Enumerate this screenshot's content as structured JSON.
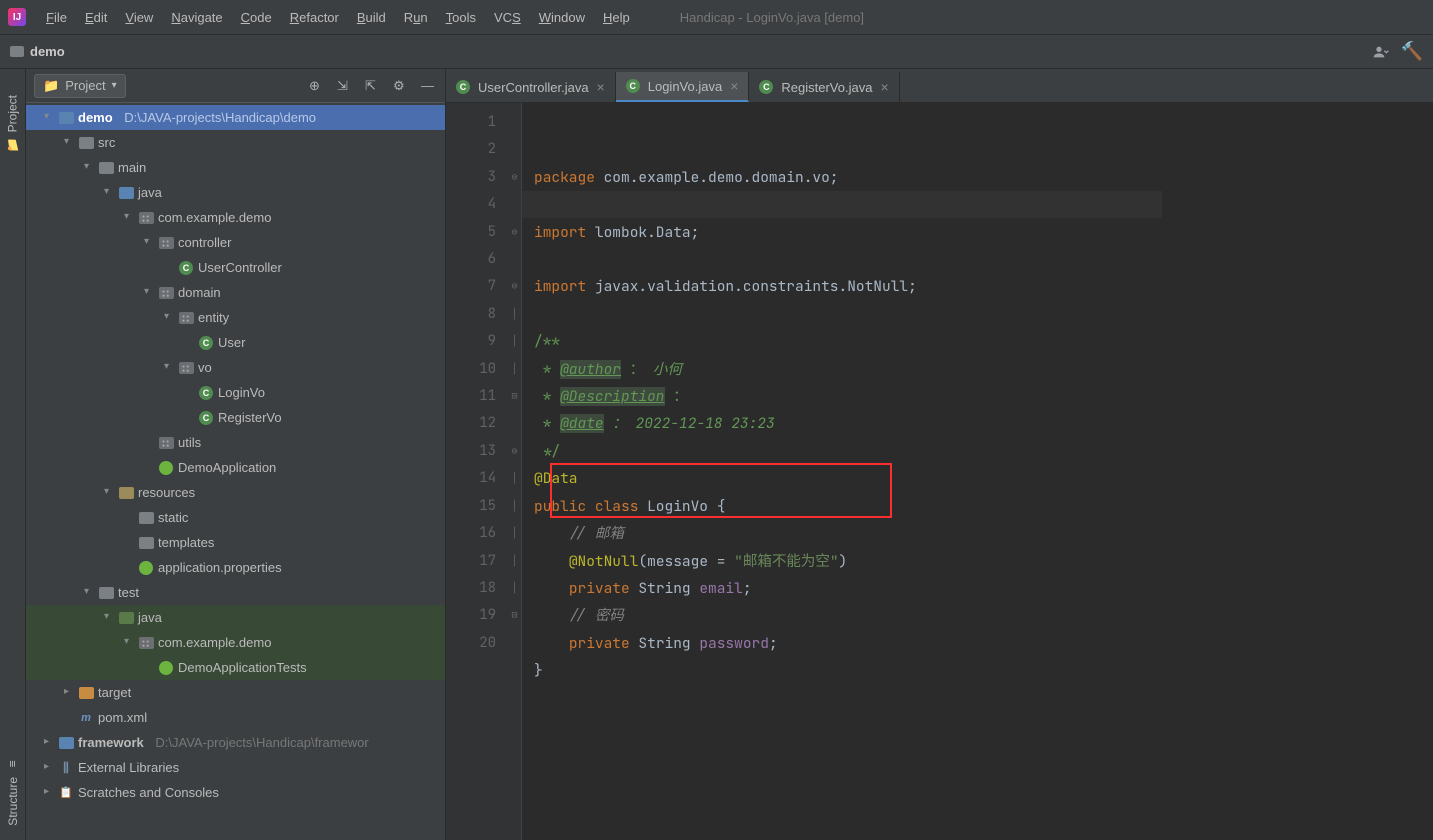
{
  "menubar": [
    "File",
    "Edit",
    "View",
    "Navigate",
    "Code",
    "Refactor",
    "Build",
    "Run",
    "Tools",
    "VCS",
    "Window",
    "Help"
  ],
  "menubar_mnemonics": [
    "F",
    "E",
    "V",
    "N",
    "C",
    "R",
    "B",
    "R",
    "T",
    "S",
    "W",
    "H"
  ],
  "window_title": "Handicap - LoginVo.java [demo]",
  "breadcrumb": "demo",
  "project_panel": {
    "title": "Project"
  },
  "tree": {
    "root": {
      "label": "demo",
      "path": "D:\\JAVA-projects\\Handicap\\demo"
    },
    "src": "src",
    "main": "main",
    "java": "java",
    "pkg": "com.example.demo",
    "controller": "controller",
    "usercontroller": "UserController",
    "domain": "domain",
    "entity": "entity",
    "user": "User",
    "vo": "vo",
    "loginvo": "LoginVo",
    "registervo": "RegisterVo",
    "utils": "utils",
    "demoapp": "DemoApplication",
    "resources": "resources",
    "static": "static",
    "templates": "templates",
    "appprops": "application.properties",
    "test": "test",
    "testjava": "java",
    "testpkg": "com.example.demo",
    "demotests": "DemoApplicationTests",
    "target": "target",
    "pom": "pom.xml",
    "framework": {
      "label": "framework",
      "path": "D:\\JAVA-projects\\Handicap\\framewor"
    },
    "extlibs": "External Libraries",
    "scratches": "Scratches and Consoles"
  },
  "tabs": [
    {
      "label": "UserController.java"
    },
    {
      "label": "LoginVo.java"
    },
    {
      "label": "RegisterVo.java"
    }
  ],
  "code": {
    "l1a": "package",
    "l1b": " com.example.demo.domain.vo;",
    "l3a": "import",
    "l3b": " lombok.Data;",
    "l5a": "import",
    "l5b": " javax.validation.constraints.NotNull;",
    "l7": "/**",
    "l8a": " * ",
    "l8b": "@author",
    "l8c": " ： ",
    "l8d": "小何",
    "l9a": " * ",
    "l9b": "@Description",
    "l9c": " ：",
    "l10a": " * ",
    "l10b": "@date",
    "l10c": " ： 2022-12-18 23:23",
    "l11": " */",
    "l12": "@Data",
    "l13a": "public class ",
    "l13b": "LoginVo ",
    "l13c": "{",
    "l14": "// 邮箱",
    "l15a": "@NotNull",
    "l15b": "(message = ",
    "l15c": "\"邮箱不能为空\"",
    "l15d": ")",
    "l16a": "private ",
    "l16b": "String ",
    "l16c": "email",
    "l16d": ";",
    "l17": "// 密码",
    "l18a": "private ",
    "l18b": "String ",
    "l18c": "password",
    "l18d": ";",
    "l19": "}"
  },
  "lines": [
    "1",
    "2",
    "3",
    "4",
    "5",
    "6",
    "7",
    "8",
    "9",
    "10",
    "11",
    "12",
    "13",
    "14",
    "15",
    "16",
    "17",
    "18",
    "19",
    "20"
  ]
}
